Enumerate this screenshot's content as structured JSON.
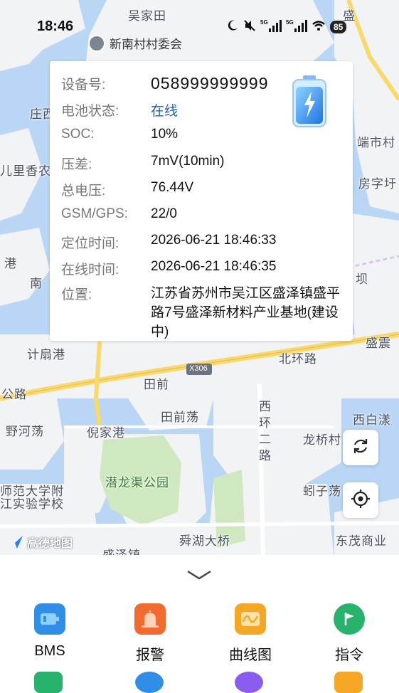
{
  "status_bar": {
    "time": "18:46",
    "battery": "85",
    "network": "5G"
  },
  "map": {
    "poi_label": "新南村村委会",
    "labels": [
      "吴家田",
      "盛",
      "庄西",
      "端市村",
      "儿里香农庄",
      "房字圩",
      "港",
      "南",
      "坝",
      "计扇港",
      "盛震",
      "北环路",
      "X306",
      "田前",
      "公路",
      "西环二路",
      "西白漾",
      "野河荡",
      "倪家港",
      "田前荡",
      "龙桥村",
      "潜龙渠公园",
      "师范大学附",
      "江实验学校",
      "蚓子荡",
      "舜湖大桥",
      "东茂商业",
      "盛泽镇"
    ],
    "logo": "高德地图"
  },
  "info_card": {
    "rows": [
      {
        "label": "设备号:",
        "value": "058999999999"
      },
      {
        "label": "电池状态:",
        "value": "在线"
      },
      {
        "label": "SOC:",
        "value": "10%"
      },
      {
        "label": "压差:",
        "value": "7mV(10min)"
      },
      {
        "label": "总电压:",
        "value": "76.44V"
      },
      {
        "label": "GSM/GPS:",
        "value": "22/0"
      },
      {
        "label": "定位时间:",
        "value": "2026-06-21 18:46:33"
      },
      {
        "label": "在线时间:",
        "value": "2026-06-21 18:46:35"
      },
      {
        "label": "位置:",
        "value": "江苏省苏州市吴江区盛泽镇盛平路7号盛泽新材料产业基地(建设中)"
      }
    ]
  },
  "actions": [
    {
      "label": "BMS",
      "icon": "battery-icon",
      "color": "#2f8fe8"
    },
    {
      "label": "报警",
      "icon": "alarm-icon",
      "color": "#f26a2e"
    },
    {
      "label": "曲线图",
      "icon": "curve-icon",
      "color": "#f5a623"
    },
    {
      "label": "指令",
      "icon": "flag-icon",
      "color": "#27b36b"
    }
  ],
  "colors": {
    "water": "#b9d6f5",
    "land": "#f2f3f5",
    "park": "#cfe8c0",
    "road": "#f8d96a",
    "accent": "#1f5fb8"
  }
}
